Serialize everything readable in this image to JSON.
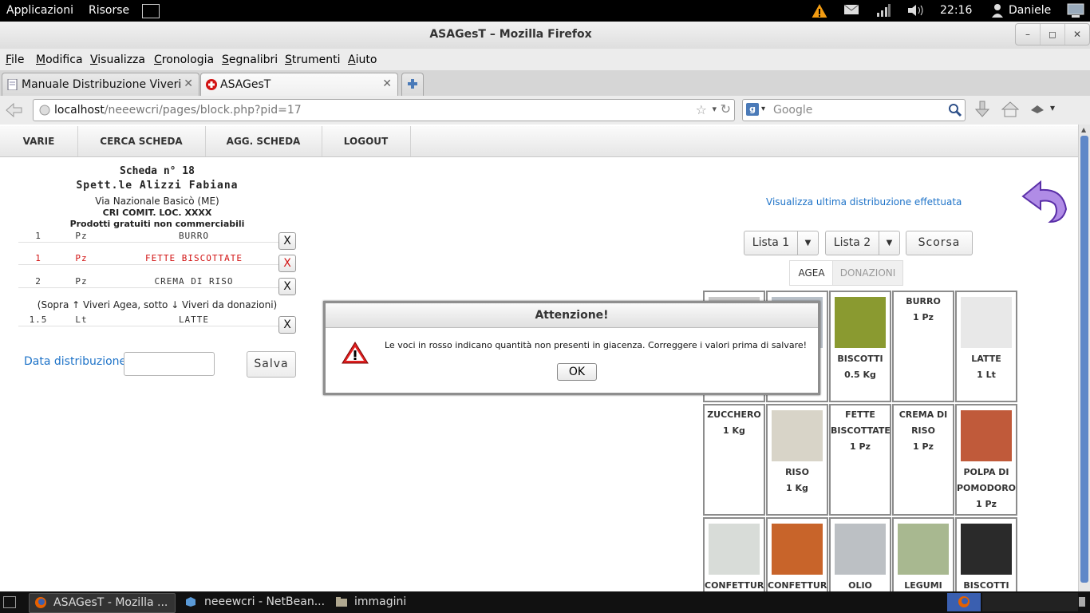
{
  "panel": {
    "apps": "Applicazioni",
    "places": "Risorse",
    "time": "22:16",
    "user": "Daniele"
  },
  "window": {
    "title": "ASAGesT – Mozilla Firefox",
    "ctrl_min": "–",
    "ctrl_max": "◻",
    "ctrl_close": "✕"
  },
  "menu": [
    "File",
    "Modifica",
    "Visualizza",
    "Cronologia",
    "Segnalibri",
    "Strumenti",
    "Aiuto"
  ],
  "tabs": [
    {
      "label": "Manuale Distribuzione Viveri"
    },
    {
      "label": "ASAGesT"
    }
  ],
  "tab_close": "✕",
  "nav": {
    "url_host": "localhost",
    "url_path": "/neeewcri/pages/block.php?pid=17",
    "search_placeholder": "Google"
  },
  "topnav": [
    "VARIE",
    "CERCA SCHEDA",
    "AGG. SCHEDA",
    "LOGOUT"
  ],
  "scheda": {
    "title": "Scheda n° 18",
    "name": "Spett.le Alizzi Fabiana",
    "address": "Via Nazionale Basicò (ME)",
    "committee": "CRI COMIT. LOC. XXXX",
    "note": "Prodotti gratuiti non commerciabili",
    "separator": "(Sopra ↑ Viveri Agea, sotto ↓ Viveri da donazioni)",
    "items_agea": [
      {
        "qty": "1",
        "unit": "Pz",
        "name": "BURRO",
        "red": false
      },
      {
        "qty": "1",
        "unit": "Pz",
        "name": "FETTE BISCOTTATE",
        "red": true
      },
      {
        "qty": "2",
        "unit": "Pz",
        "name": "CREMA DI RISO",
        "red": false
      }
    ],
    "items_donazioni": [
      {
        "qty": "1.5",
        "unit": "Lt",
        "name": "LATTE",
        "red": false
      }
    ],
    "remove_label": "X",
    "date_label": "Data distribuzione:",
    "date_value": "",
    "save_label": "Salva"
  },
  "right": {
    "last_link": "Visualizza ultima distribuzione effettuata",
    "lista1": "Lista 1",
    "lista2": "Lista 2",
    "scorsa": "Scorsa",
    "tab_agea": "AGEA",
    "tab_donazioni": "DONAZIONI"
  },
  "products": [
    {
      "name": "",
      "qty": "",
      "img": true
    },
    {
      "name": "",
      "qty": "",
      "img": true
    },
    {
      "name": "BISCOTTI",
      "qty": "0.5 Kg",
      "img": true
    },
    {
      "name": "BURRO",
      "qty": "1 Pz",
      "img": false
    },
    {
      "name": "LATTE",
      "qty": "1 Lt",
      "img": true
    },
    {
      "name": "ZUCCHERO",
      "qty": "1 Kg",
      "img": false
    },
    {
      "name": "RISO",
      "qty": "1 Kg",
      "img": true
    },
    {
      "name": "FETTE BISCOTTATE",
      "qty": "1 Pz",
      "img": false
    },
    {
      "name": "CREMA DI RISO",
      "qty": "1 Pz",
      "img": false
    },
    {
      "name": "POLPA DI POMODORO",
      "qty": "1 Pz",
      "img": true
    },
    {
      "name": "CONFETTURA",
      "qty": "",
      "img": true
    },
    {
      "name": "CONFETTURA",
      "qty": "",
      "img": true
    },
    {
      "name": "OLIO",
      "qty": "",
      "img": true
    },
    {
      "name": "LEGUMI",
      "qty": "",
      "img": true
    },
    {
      "name": "BISCOTTI",
      "qty": "",
      "img": true
    }
  ],
  "dialog": {
    "title": "Attenzione!",
    "message": "Le voci in rosso indicano quantità non presenti in giacenza. Correggere i valori prima di salvare!",
    "ok": "OK"
  },
  "taskbar": [
    {
      "label": "ASAGesT - Mozilla ..."
    },
    {
      "label": "neeewcri - NetBean..."
    },
    {
      "label": "immagini"
    }
  ],
  "colors": {
    "accent": "#5f88c8",
    "link": "#1e73c8",
    "error": "#d21414"
  }
}
